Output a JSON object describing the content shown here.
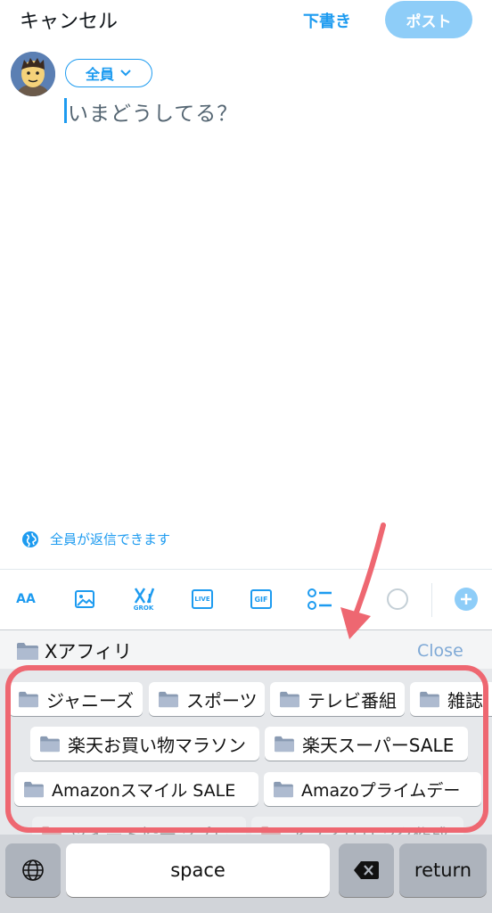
{
  "header": {
    "cancel_label": "キャンセル",
    "draft_label": "下書き",
    "post_label": "ポスト"
  },
  "compose": {
    "audience_label": "全員",
    "placeholder": "いまどうしてる？",
    "reply_setting": "全員が返信できます"
  },
  "toolbar": {
    "items": [
      "text-size-icon",
      "image-icon",
      "grok-icon",
      "live-icon",
      "gif-icon",
      "poll-icon",
      "progress-circle-icon",
      "add-post-icon"
    ],
    "text_size_label": "AA",
    "grok_label": "GROK",
    "live_label": "LIVE",
    "gif_label": "GIF"
  },
  "keyboard": {
    "title": "Xアフィリ",
    "close_label": "Close",
    "rows": [
      [
        "ジャニーズ",
        "スポーツ",
        "テレビ番組",
        "雑誌"
      ],
      [
        "楽天お買い物マラソン",
        "楽天スーパーSALE"
      ],
      [
        "Amazonスマイル SALE",
        "Amazoプライムデー"
      ],
      [
        "ツイート投テンプレ",
        "アフィリリンク作成"
      ]
    ],
    "space_label": "space",
    "return_label": "return"
  },
  "colors": {
    "accent": "#1d9bf0",
    "post_disabled": "#8ecdf8",
    "annotation": "#ee6771"
  }
}
